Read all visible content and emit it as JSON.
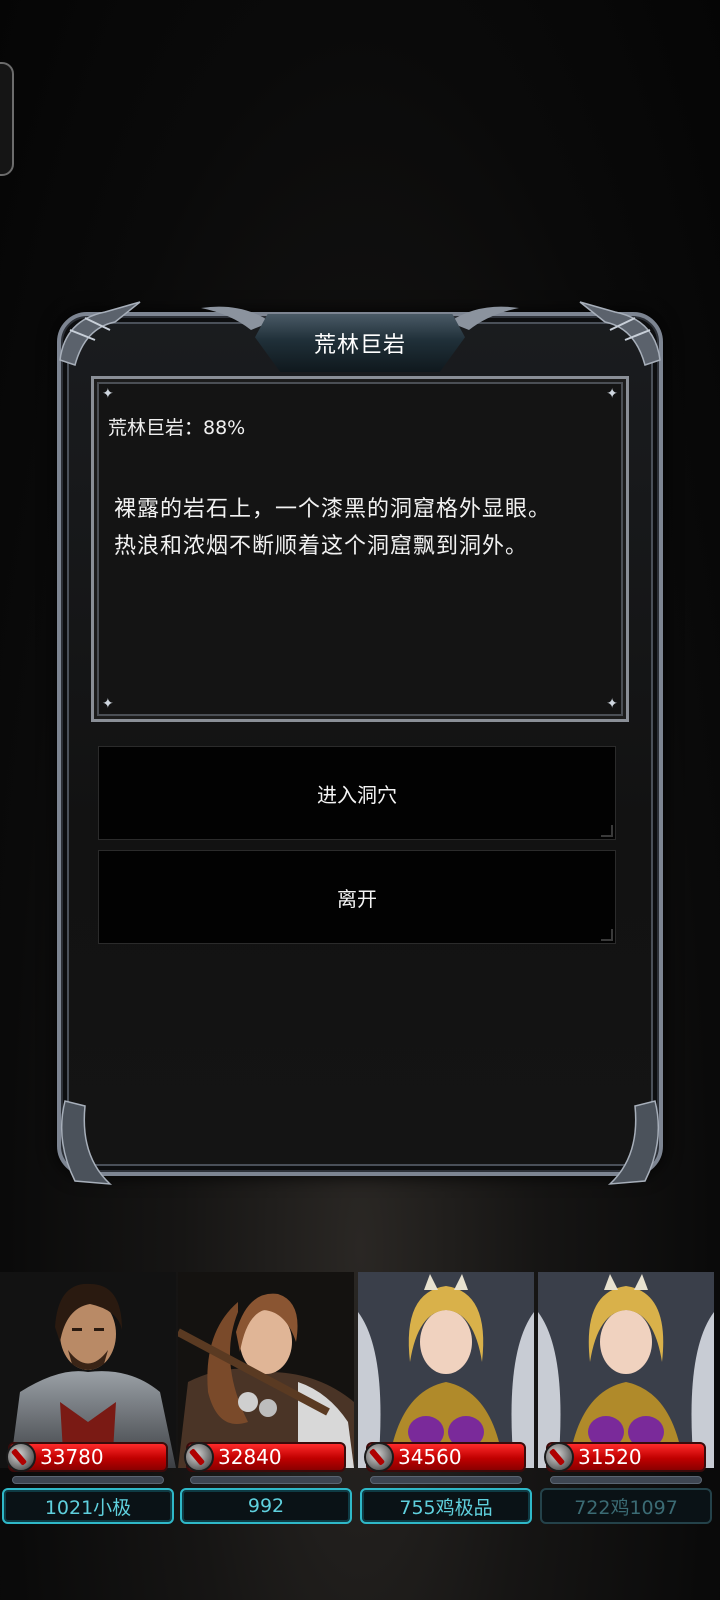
{
  "dialog": {
    "title": "荒林巨岩",
    "progress_text": "荒林巨岩：88%",
    "description_line1": "裸露的岩石上，一个漆黑的洞窟格外显眼。",
    "description_line2": "热浪和浓烟不断顺着这个洞窟飘到洞外。",
    "choices": [
      {
        "label": "进入洞穴"
      },
      {
        "label": "离开"
      }
    ]
  },
  "heroes": [
    {
      "hp": "33780",
      "name": "1021小极",
      "portrait": "warrior-man"
    },
    {
      "hp": "32840",
      "name": "992",
      "portrait": "archer-woman"
    },
    {
      "hp": "34560",
      "name": "755鸡极品",
      "portrait": "valkyrie-blonde"
    },
    {
      "hp": "31520",
      "name": "722鸡1097",
      "portrait": "valkyrie-blonde"
    }
  ],
  "colors": {
    "hp_bar": "#e01010",
    "name_plate_border": "#2fb8c8",
    "frame": "#7d8592"
  }
}
